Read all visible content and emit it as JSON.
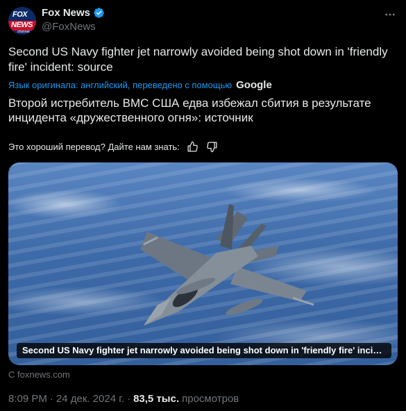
{
  "account": {
    "display_name": "Fox News",
    "handle": "@FoxNews",
    "avatar_text_1": "FOX",
    "avatar_text_2": "NEWS",
    "avatar_text_3": "channel",
    "verified_icon": "verified-badge-icon"
  },
  "post": {
    "original_text": "Second US Navy fighter jet narrowly avoided being shot down in 'friendly fire' incident: source",
    "translation_note": "Язык оригинала: английский, переведено с помощью",
    "translation_provider": "Google",
    "translated_text": "Второй истребитель ВМС США едва избежал сбития в результате инцидента «дружественного огня»: источник",
    "feedback_prompt": "Это хороший перевод? Дайте нам знать:"
  },
  "card": {
    "caption": "Second US Navy fighter jet narrowly avoided being shot down in 'friendly fire' incident: ...",
    "source": "С foxnews.com"
  },
  "meta": {
    "time": "8:09 PM",
    "date": "24 дек. 2024 г.",
    "separator": "·",
    "views_count": "83,5 тыс.",
    "views_label": "просмотров"
  },
  "colors": {
    "background": "#000000",
    "text": "#e7e9ea",
    "muted": "#71767b",
    "accent": "#1d9bf0"
  }
}
